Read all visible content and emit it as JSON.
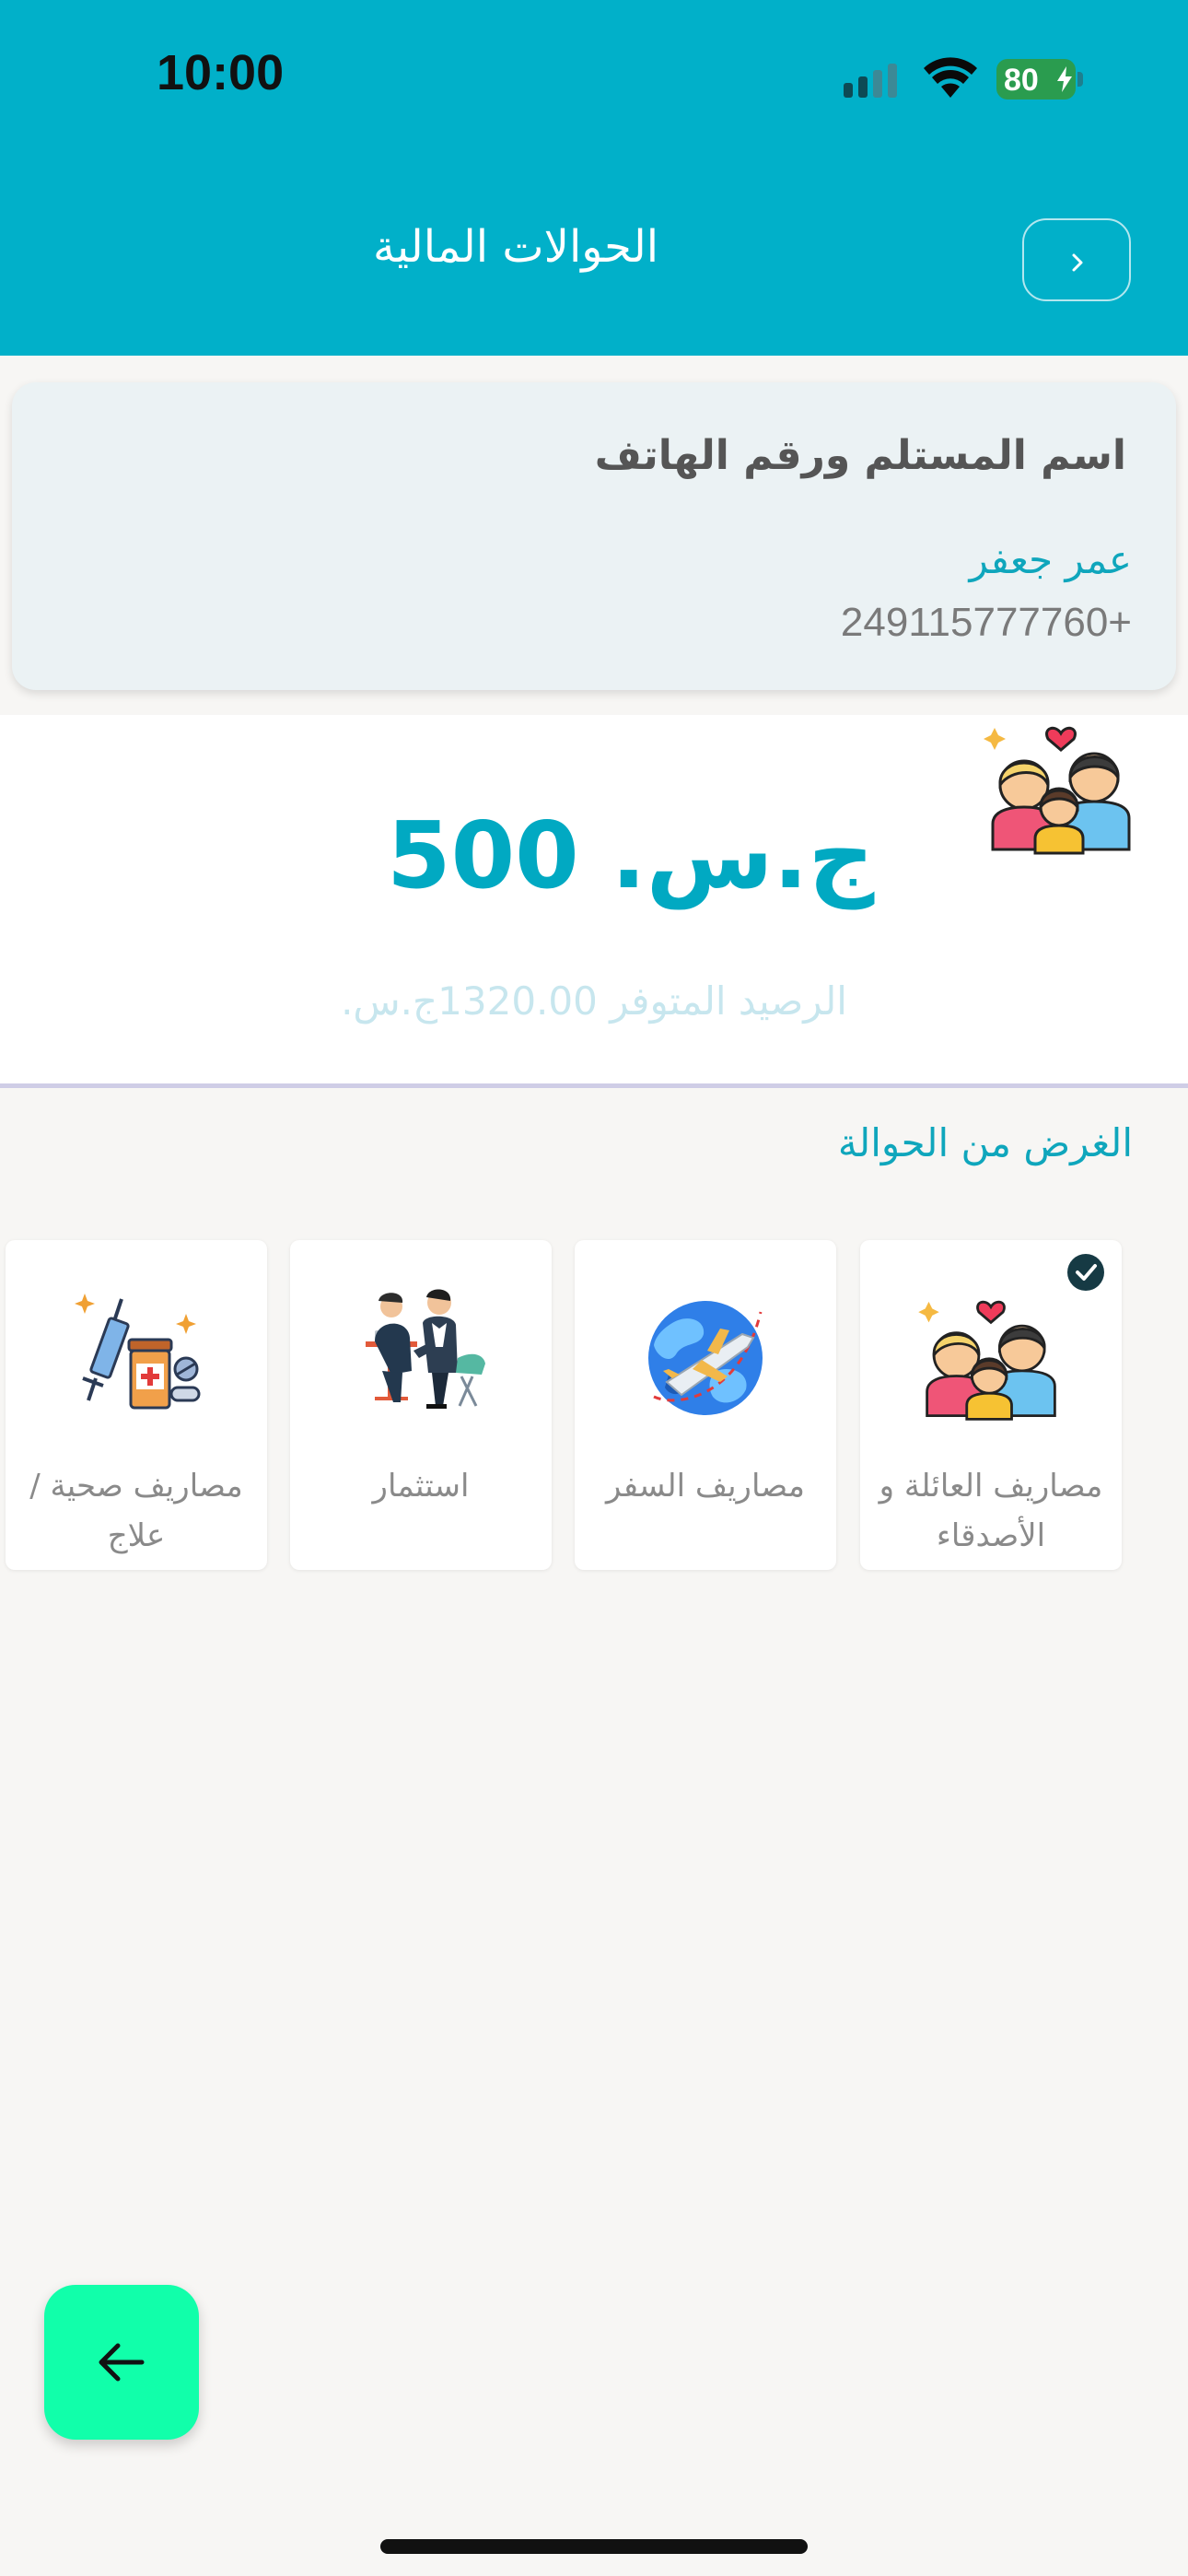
{
  "status_bar": {
    "time": "10:00",
    "battery": "80"
  },
  "header": {
    "title": "الحوالات المالية"
  },
  "recipient": {
    "label": "اسم المستلم ورقم الهاتف",
    "name": "عمر جعفر",
    "phone": "249115777760+"
  },
  "amount": {
    "value": "500",
    "currency": "ج.س."
  },
  "balance_text": "الرصيد المتوفر 1320.00ج.س.",
  "purpose": {
    "label": "الغرض من الحوالة",
    "options": [
      {
        "label": "مصاريف العائلة و الأصدقاء",
        "icon": "family-icon",
        "selected": true
      },
      {
        "label": "مصاريف السفر",
        "icon": "travel-globe-icon",
        "selected": false
      },
      {
        "label": "استثمار",
        "icon": "business-meeting-icon",
        "selected": false
      },
      {
        "label": "مصاريف صحية / علاج",
        "icon": "medical-icon",
        "selected": false
      }
    ]
  },
  "colors": {
    "header": "#01b0c9",
    "accent": "#01a9c2",
    "fab": "#11ffaa"
  }
}
